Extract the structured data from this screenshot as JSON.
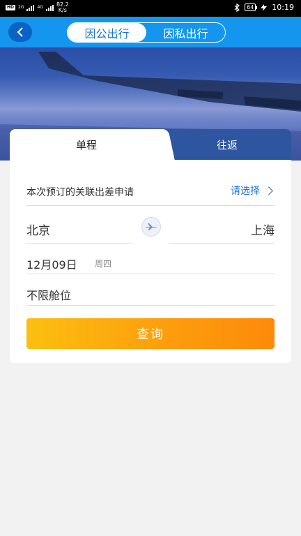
{
  "status_bar": {
    "left_icons": [
      "hd-icon",
      "2g-signal-icon",
      "4g-signal-icon"
    ],
    "hd_label": "HD",
    "net1_label": "2G",
    "net2_label": "4G",
    "speed_value": "82.2",
    "speed_unit": "K/s",
    "battery": "64",
    "time": "10:19"
  },
  "header": {
    "tabs": [
      {
        "label": "因公出行",
        "active": true
      },
      {
        "label": "因私出行",
        "active": false
      }
    ]
  },
  "trip_tabs": [
    {
      "label": "单程",
      "active": true
    },
    {
      "label": "往返",
      "active": false
    }
  ],
  "form": {
    "apply_label": "本次预订的关联出差申请",
    "apply_select": "请选择",
    "from_city": "北京",
    "to_city": "上海",
    "date": "12月09日",
    "weekday": "周四",
    "cabin": "不限舱位",
    "search_button": "查询"
  },
  "colors": {
    "header_blue": "#1496ee",
    "link_blue": "#1a73d9",
    "button_orange": "#fd9e0c"
  }
}
